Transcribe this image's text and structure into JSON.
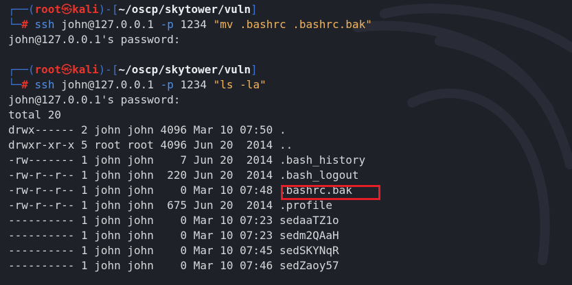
{
  "prompts": [
    {
      "user": "root",
      "skull": "㉿",
      "host": "kali",
      "cwd": "~/oscp/skytower/vuln",
      "cmd": "ssh",
      "args1": " john@127.0.0.1 ",
      "flag": "-p",
      "args2": " 1234 ",
      "str": "\"mv .bashrc .bashrc.bak\""
    },
    {
      "user": "root",
      "skull": "㉿",
      "host": "kali",
      "cwd": "~/oscp/skytower/vuln",
      "cmd": "ssh",
      "args1": " john@127.0.0.1 ",
      "flag": "-p",
      "args2": " 1234 ",
      "str": "\"ls -la\""
    }
  ],
  "output1": "john@127.0.0.1's password:",
  "output2": [
    "john@127.0.0.1's password:",
    "total 20",
    "drwx------ 2 john john 4096 Mar 10 07:50 .",
    "drwxr-xr-x 5 root root 4096 Jun 20  2014 ..",
    "-rw------- 1 john john    7 Jun 20  2014 .bash_history",
    "-rw-r--r-- 1 john john  220 Jun 20  2014 .bash_logout",
    "-rw-r--r-- 1 john john    0 Mar 10 07:48 .bashrc.bak",
    "-rw-r--r-- 1 john john  675 Jun 20  2014 .profile",
    "---------- 1 john john    0 Mar 10 07:23 sedaaTZ1o",
    "---------- 1 john john    0 Mar 10 07:23 sedm2QAaH",
    "---------- 1 john john    0 Mar 10 07:45 sedSKYNqR",
    "---------- 1 john john    0 Mar 10 07:46 sedZaoy57"
  ],
  "highlight_color": "#e41e26",
  "colors": {
    "background": "#1f2129",
    "prompt_frame": "#3c74d0",
    "prompt_user": "#e8352b",
    "command": "#4e8fe8",
    "string": "#f0b35a",
    "text": "#d6d8dc"
  }
}
